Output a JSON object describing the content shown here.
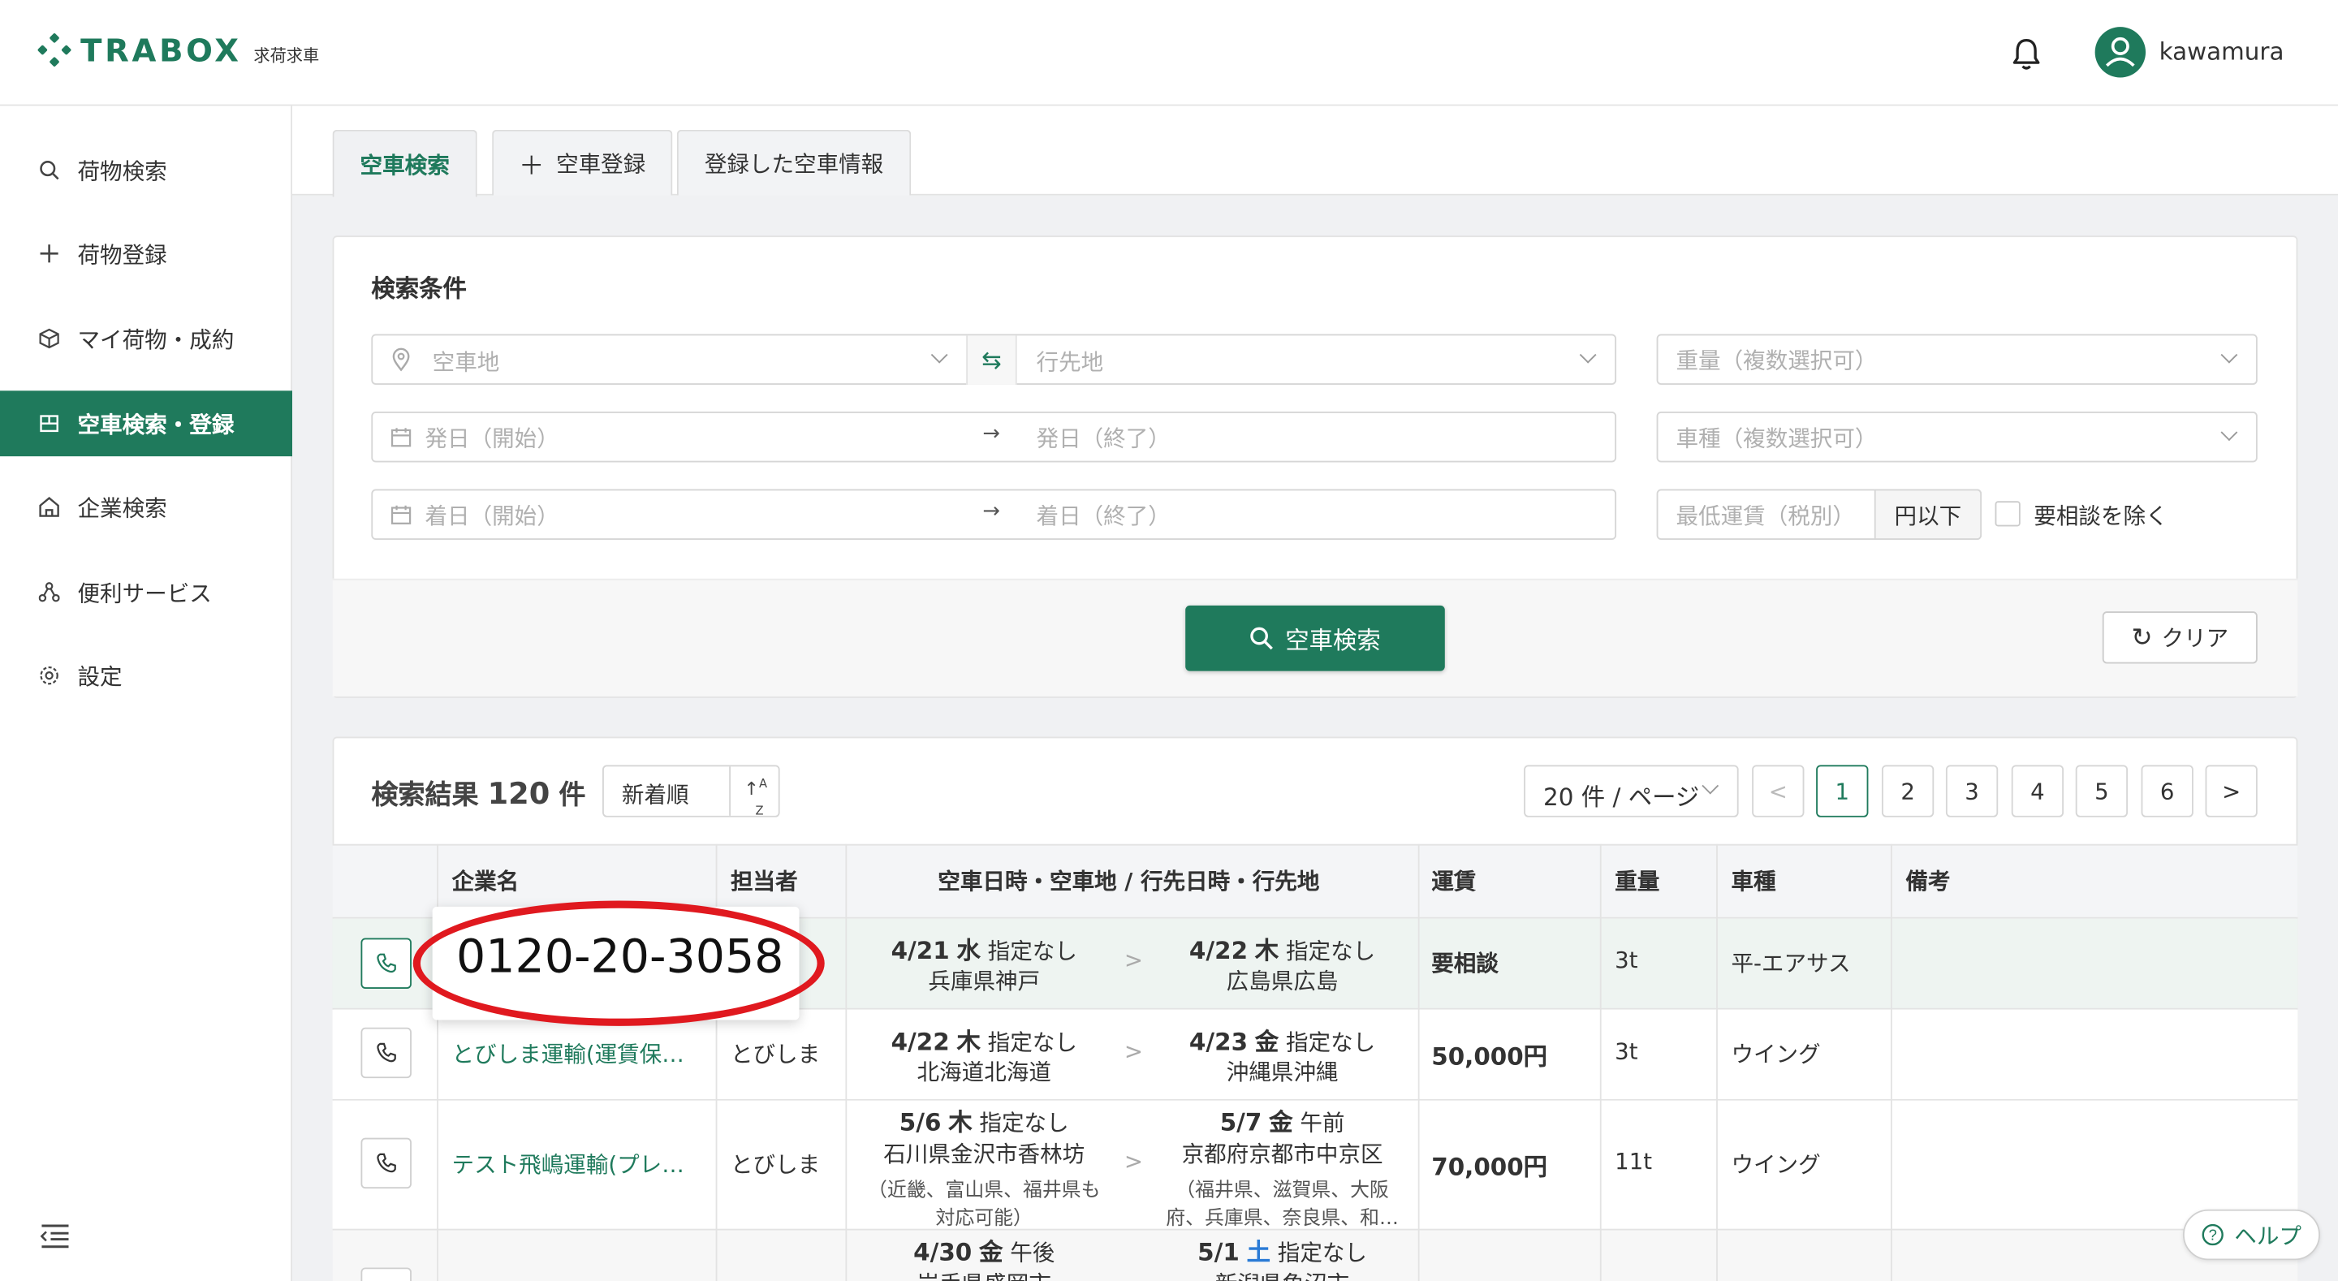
{
  "app": {
    "logo_text": "TRABOX",
    "logo_sub": "求荷求車",
    "user_name": "kawamura"
  },
  "sidebar": {
    "items": [
      {
        "label": "荷物検索",
        "icon": "search-icon"
      },
      {
        "label": "荷物登録",
        "icon": "plus-icon"
      },
      {
        "label": "マイ荷物・成約",
        "icon": "box-icon"
      },
      {
        "label": "空車検索・登録",
        "icon": "truck-icon",
        "active": true
      },
      {
        "label": "企業検索",
        "icon": "building-icon"
      },
      {
        "label": "便利サービス",
        "icon": "network-icon"
      },
      {
        "label": "設定",
        "icon": "gear-icon"
      }
    ]
  },
  "tabs": [
    {
      "label": "空車検索",
      "active": true
    },
    {
      "label": "空車登録",
      "icon": "plus-icon"
    },
    {
      "label": "登録した空車情報"
    }
  ],
  "search": {
    "title": "検索条件",
    "origin_placeholder": "空車地",
    "dest_placeholder": "行先地",
    "weight_placeholder": "重量（複数選択可）",
    "dep_start_placeholder": "発日（開始）",
    "dep_end_placeholder": "発日（終了）",
    "vehicle_placeholder": "車種（複数選択可）",
    "arr_start_placeholder": "着日（開始）",
    "arr_end_placeholder": "着日（終了）",
    "fare_placeholder": "最低運賃（税別）",
    "fare_suffix": "円以下",
    "exclude_label": "要相談を除く",
    "search_button": "空車検索",
    "clear_button": "クリア"
  },
  "results": {
    "title": "検索結果",
    "count": "120",
    "count_suffix": "件",
    "sort_label": "新着順",
    "per_page": "20 件 / ページ",
    "pages": [
      "1",
      "2",
      "3",
      "4",
      "5",
      "6"
    ],
    "current_page": "1"
  },
  "table": {
    "headers": [
      "企業名",
      "担当者",
      "空車日時・空車地 / 行先日時・行先地",
      "運賃",
      "重量",
      "車種",
      "備考"
    ],
    "rows": [
      {
        "company": "",
        "person": "",
        "from_date": "4/21",
        "from_dow": "水",
        "from_time": "指定なし",
        "from_place": "兵庫県神戸",
        "from_note": "",
        "to_date": "4/22",
        "to_dow": "木",
        "to_time": "指定なし",
        "to_place": "広島県広島",
        "to_note": "",
        "fare": "要相談",
        "weight": "3t",
        "vehicle": "平-エアサス",
        "note": ""
      },
      {
        "company": "とびしま運輸(運賃保…",
        "person": "とびしま",
        "from_date": "4/22",
        "from_dow": "木",
        "from_time": "指定なし",
        "from_place": "北海道北海道",
        "from_note": "",
        "to_date": "4/23",
        "to_dow": "金",
        "to_time": "指定なし",
        "to_place": "沖縄県沖縄",
        "to_note": "",
        "fare": "50,000円",
        "weight": "3t",
        "vehicle": "ウイング",
        "note": ""
      },
      {
        "company": "テスト飛嶋運輸(プレ…",
        "person": "とびしま",
        "from_date": "5/6",
        "from_dow": "木",
        "from_time": "指定なし",
        "from_place": "石川県金沢市香林坊",
        "from_note_1": "（近畿、富山県、福井県も",
        "from_note_2": "対応可能）",
        "to_date": "5/7",
        "to_dow": "金",
        "to_time": "午前",
        "to_place": "京都府京都市中京区",
        "to_note_1": "（福井県、滋賀県、大阪",
        "to_note_2": "府、兵庫県、奈良県、和…",
        "fare": "70,000円",
        "weight": "11t",
        "vehicle": "ウイング",
        "note": ""
      },
      {
        "company": "",
        "person": "",
        "from_date": "4/30",
        "from_dow": "金",
        "from_time": "午後",
        "from_place": "岩手県盛岡市",
        "to_date": "5/1",
        "to_dow": "土",
        "to_time": "指定なし",
        "to_place": "新潟県魚沼市",
        "fare": "",
        "weight": "",
        "vehicle": "",
        "note": ""
      }
    ]
  },
  "tooltip": {
    "phone": "0120-20-3058"
  },
  "help": {
    "label": "ヘルプ"
  },
  "colors": {
    "brand": "#1f7a5c",
    "highlight": "#e0191f",
    "saturday": "#2a7bd6"
  }
}
